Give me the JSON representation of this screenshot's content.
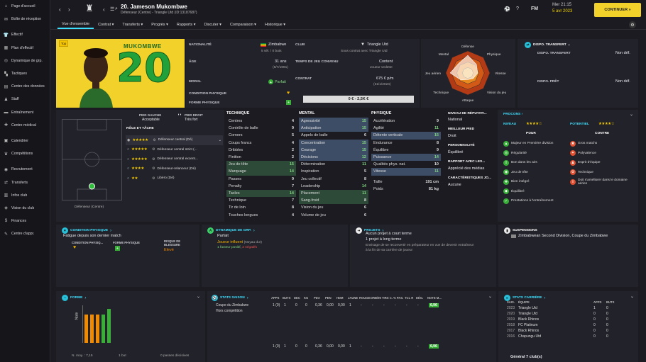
{
  "sidebar": {
    "items": [
      {
        "label": "Page d'accueil",
        "icon": "home-icon"
      },
      {
        "label": "Boîte de réception",
        "icon": "inbox-icon"
      },
      {
        "label": "Effectif",
        "icon": "shirt-icon"
      },
      {
        "label": "Plan d'effectif",
        "icon": "plan-icon"
      },
      {
        "label": "Dynamique de grp.",
        "icon": "group-icon"
      },
      {
        "label": "Tactiques",
        "icon": "tactics-icon"
      },
      {
        "label": "Centre des données",
        "icon": "data-icon"
      },
      {
        "label": "Staff",
        "icon": "staff-icon"
      },
      {
        "label": "Entraînement",
        "icon": "training-icon"
      },
      {
        "label": "Centre médical",
        "icon": "medical-icon"
      },
      {
        "label": "Calendrier",
        "icon": "calendar-icon"
      },
      {
        "label": "Compétitions",
        "icon": "trophy-icon"
      },
      {
        "label": "Recrutement",
        "icon": "scout-icon"
      },
      {
        "label": "Transferts",
        "icon": "transfer-icon"
      },
      {
        "label": "Infos club",
        "icon": "info-icon"
      },
      {
        "label": "Vision du club",
        "icon": "vision-icon"
      },
      {
        "label": "Finances",
        "icon": "finance-icon"
      },
      {
        "label": "Centre d'appr.",
        "icon": "learn-icon"
      }
    ]
  },
  "header": {
    "name": "20. Jameson Mukombwe",
    "sub": "Défenseur (Centre) - Triangle Utd (ID:13187687)",
    "date1": "Mer 21:15",
    "date2": "5 avr 2023",
    "continue": "CONTINUER",
    "fm": "FM"
  },
  "tabs": [
    "Vue d'ensemble",
    "Contrat",
    "Transferts",
    "Progrès",
    "Rapports",
    "Discuter",
    "Comparaison",
    "Historique"
  ],
  "profile": {
    "shirt_name": "MUKOMBWE",
    "shirt_number": "20",
    "tag": "Top",
    "nationality_label": "NATIONALITÉ",
    "nationality": "Zimbabwe",
    "caps": "5 sél. / 0 buts",
    "club_label": "CLUB",
    "club": "Triangle Utd",
    "club_sub": "Sous contrat avec Triangle Utd",
    "age_label": "ÂGE",
    "age": "31 ans",
    "dob": "(5/7/1991)",
    "playtime_label": "TEMPS DE JEU CONVENU",
    "playtime": "Content",
    "playtime_sub": "Joueur vedette",
    "morale_label": "MORAL",
    "morale": "Parfait",
    "contract_label": "CONTRAT",
    "contract": "675 € p/m",
    "contract_sub": "(31/1/2024)",
    "condition_label": "CONDITION PHYSIQUE",
    "form_label": "FORME PHYSIQUE",
    "value": "0 € - 2,5K €"
  },
  "radar": {
    "labels": [
      "Défense",
      "Physique",
      "Vitesse",
      "Vision du jeu",
      "Attaque",
      "Technique",
      "Jeu aérien",
      "Mental"
    ]
  },
  "transfer": {
    "title": "DISPO. TRANSFERT",
    "r1l": "DISPO. TRANSFERT",
    "r1v": "Non déf.",
    "r2l": "DISPO. PRÊT",
    "r2v": "Non déf."
  },
  "pitch": {
    "left_foot_label": "PIED GAUCHE",
    "left_foot": "Acceptable",
    "right_foot_label": "PIED DROIT",
    "right_foot": "Très fort",
    "role_title": "RÔLE ET TÂCHE",
    "position": "Défenseur (Centre)",
    "roles": [
      {
        "stars": "★★★★★",
        "name": "Défenseur central (Dé)"
      },
      {
        "stars": "★★★★★",
        "name": "Défenseur central strict (..."
      },
      {
        "stars": "★★★★★",
        "name": "Défenseur central excent..."
      },
      {
        "stars": "★★★★",
        "name": "Défenseur-relanceur (Dé)"
      },
      {
        "stars": "★★",
        "name": "Libéro (Dé)"
      }
    ]
  },
  "technique": {
    "title": "TECHNIQUE",
    "rows": [
      [
        "Centres",
        "4"
      ],
      [
        "Contrôle de balle",
        "9"
      ],
      [
        "Corners",
        "5"
      ],
      [
        "Coups francs",
        "4"
      ],
      [
        "Dribbles",
        "2"
      ],
      [
        "Finition",
        "2"
      ],
      [
        "Jeu de tête",
        "15"
      ],
      [
        "Marquage",
        "14"
      ],
      [
        "Passes",
        "9"
      ],
      [
        "Penalty",
        "7"
      ],
      [
        "Tacles",
        "14"
      ],
      [
        "Technique",
        "7"
      ],
      [
        "Tir de loin",
        "8"
      ],
      [
        "Touches longues",
        "4"
      ]
    ]
  },
  "mental": {
    "title": "MENTAL",
    "rows": [
      [
        "Agressivité",
        "15"
      ],
      [
        "Anticipation",
        "15"
      ],
      [
        "Appels de balle",
        "6"
      ],
      [
        "Concentration",
        "15"
      ],
      [
        "Courage",
        "15"
      ],
      [
        "Décisions",
        "12"
      ],
      [
        "Détermination",
        "11"
      ],
      [
        "Inspiration",
        "5"
      ],
      [
        "Jeu collectif",
        "8"
      ],
      [
        "Leadership",
        "14"
      ],
      [
        "Placement",
        "11"
      ],
      [
        "Sang-froid",
        "8"
      ],
      [
        "Vision du jeu",
        "6"
      ],
      [
        "Volume de jeu",
        "6"
      ]
    ]
  },
  "physique": {
    "title": "PHYSIQUE",
    "rows": [
      [
        "Accélération",
        "9"
      ],
      [
        "Agilité",
        "11"
      ],
      [
        "Détente verticale",
        "15"
      ],
      [
        "Endurance",
        "8"
      ],
      [
        "Équilibre",
        "9"
      ],
      [
        "Puissance",
        "14"
      ],
      [
        "Qualités phys. nat.",
        "10"
      ],
      [
        "Vitesse",
        "11"
      ]
    ],
    "height_label": "Taille",
    "height": "191 cm",
    "weight_label": "Poids",
    "weight": "81 kg"
  },
  "info": {
    "rep_label": "NIVEAU DE RÉPUTATI...",
    "rep": "National",
    "foot_label": "MEILLEUR PIED",
    "foot": "Droit",
    "pers_label": "PERSONNALITÉ",
    "pers": "Équilibré",
    "media_label": "RAPPORT AVEC LES...",
    "media": "Apprécié des médias",
    "char_label": "CARACTÉRISTIQUES JO...",
    "char": "Aucune"
  },
  "procons": {
    "title": "PROCONS",
    "niveau": "NIVEAU",
    "potentiel": "POTENTIEL",
    "pour": "POUR",
    "contre": "CONTRE",
    "pros": [
      "Majeur en Première division",
      "Régularité",
      "Bon dans les airs",
      "Jeu de tête",
      "Bien intégré",
      "Équilibré",
      "Prestations à l'entraînement"
    ],
    "cons": [
      "Gros matchs",
      "Polyvalence",
      "Esprit d'équipe",
      "Technique",
      "Doit s'améliorer dans le domaine aérien"
    ]
  },
  "condition": {
    "title": "CONDITION PHYSIQUE",
    "text": "Fatigue depuis son dernier match",
    "l1": "CONDITION PHYSIQ...",
    "l2": "FORME PHYSIQUE",
    "l3": "RISQUE DE BLESSURE",
    "v3": "Elevé"
  },
  "dynamics": {
    "title": "DYNAMIQUE DE GRP.",
    "v": "Parfait",
    "role": "Joueur influent",
    "role2": "(Noyau dur)",
    "pos": "1 facteur positif",
    "neg": "2 négatifs"
  },
  "projects": {
    "title": "PROJETS",
    "t1": "Aucun projet à court terme",
    "t2": "1 projet à long terme",
    "t3": "Envisage de se reconvertir en préparateur en vue de devenir entraîneur",
    "t4": "à la fin de sa carrière de joueur"
  },
  "suspensions": {
    "title": "SUSPENSIONS",
    "text": "Zimbabwean Second Division, Coupe du Zimbabwe"
  },
  "forme": {
    "title": "FORME",
    "ylabel": "Note",
    "avg": "N. moy. : 7,15",
    "goals": "1 but",
    "assists": "0 passes décisives"
  },
  "season": {
    "title": "STATS SAISON",
    "cols": [
      "APPS",
      "BUTS",
      "DEC",
      "KG",
      "PDA",
      "PEN",
      "HDM",
      "JAUNE",
      "ROUGE",
      "DRB/90",
      "TIRS C.",
      "% PAS.",
      "TCL R",
      "DÉG.",
      "NOTE M..."
    ],
    "rows": [
      [
        "Coupe du Zimbabwe",
        "1 (0)",
        "1",
        "0",
        "0",
        "0,36",
        "0,00",
        "0,00",
        "1",
        "-",
        "-",
        "-",
        "-",
        "-",
        "-",
        "6,96"
      ],
      [
        "Hors compétition",
        "",
        "",
        "",
        "",
        "",
        "",
        "",
        "",
        "",
        "",
        "",
        "",
        "",
        "",
        ""
      ],
      [
        "",
        "1 (0)",
        "1",
        "0",
        "0",
        "0,36",
        "0,00",
        "0,00",
        "1",
        "-",
        "-",
        "-",
        "-",
        "-",
        "-",
        "6,96"
      ]
    ]
  },
  "career": {
    "title": "STATS CARRIÈRE",
    "cols": [
      "SAIS.",
      "ÉQUIPE",
      "APPS",
      "BUTS"
    ],
    "rows": [
      [
        "2023",
        "Triangle Utd",
        "1",
        "0"
      ],
      [
        "2020",
        "Triangle Utd",
        "0",
        "0"
      ],
      [
        "2019",
        "Black Rhinos",
        "0",
        "0"
      ],
      [
        "2018",
        "FC Platinum",
        "0",
        "0"
      ],
      [
        "2017",
        "Black Rhinos",
        "0",
        "0"
      ],
      [
        "2016",
        "Chapungu Utd",
        "0",
        "0"
      ]
    ],
    "total": "Général 7 club(s)"
  }
}
